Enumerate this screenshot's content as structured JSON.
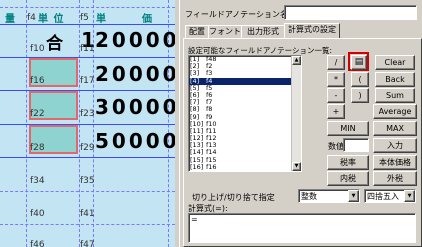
{
  "grid": {
    "header": {
      "col1": "量",
      "unit_field": "f4",
      "unit": "単 位",
      "price_field": "f5",
      "price_a": "単",
      "price_b": "価"
    },
    "row1": {
      "unit_id": "f10",
      "unit_value": "合",
      "qty_id": "f11",
      "qty_value": "1",
      "amount": "20000"
    },
    "row2": {
      "unit_id": "f16",
      "qty_id": "f17",
      "amount": "20000"
    },
    "row3": {
      "unit_id": "f22",
      "qty_id": "f23",
      "amount": "30000"
    },
    "row4": {
      "unit_id": "f28",
      "qty_id": "f29",
      "amount": "50000"
    },
    "empty": [
      {
        "a": "f34",
        "b": "f35"
      },
      {
        "a": "f40",
        "b": "f41"
      },
      {
        "a": "f46",
        "b": "f47"
      }
    ]
  },
  "dialog": {
    "field_name_label": "フィールドアノテーション名:",
    "field_name_value": "",
    "tabs": [
      "配置",
      "フォント",
      "出力形式",
      "計算式の設定"
    ],
    "active_tab": "計算式の設定",
    "list_label": "設定可能なフィールドアノテーション一覧:",
    "list_items": [
      {
        "n": "[1]",
        "v": "f48"
      },
      {
        "n": "[2]",
        "v": "f2"
      },
      {
        "n": "[3]",
        "v": "f3"
      },
      {
        "n": "[4]",
        "v": "f4"
      },
      {
        "n": "[5]",
        "v": "f5"
      },
      {
        "n": "[6]",
        "v": "f6"
      },
      {
        "n": "[7]",
        "v": "f7"
      },
      {
        "n": "[8]",
        "v": "f8"
      },
      {
        "n": "[9]",
        "v": "f9"
      },
      {
        "n": "[10]",
        "v": "f10"
      },
      {
        "n": "[11]",
        "v": "f11"
      },
      {
        "n": "[12]",
        "v": "f12"
      },
      {
        "n": "[13]",
        "v": "f13"
      },
      {
        "n": "[14]",
        "v": "f14"
      },
      {
        "n": "[15]",
        "v": "f15"
      },
      {
        "n": "[16]",
        "v": "f16"
      }
    ],
    "selected_index": 3,
    "buttons": {
      "divide": "/",
      "field_ref": "",
      "clear": "Clear",
      "multiply": "*",
      "open_paren": "(",
      "back": "Back",
      "minus": "-",
      "close_paren": ")",
      "sum": "Sum",
      "plus": "+",
      "average": "Average",
      "min": "MIN",
      "max": "MAX",
      "input": "入力",
      "tax_rate": "税率",
      "base_price": "本体価格",
      "tax_inclusive": "内税",
      "tax_exclusive": "外税"
    },
    "number_label": "数値",
    "number_value": "",
    "rounding_label": "切り上げ/切り捨て指定",
    "rounding_type": "整数",
    "rounding_method": "四捨五入",
    "formula_label": "計算式(=):",
    "formula_value": "="
  }
}
